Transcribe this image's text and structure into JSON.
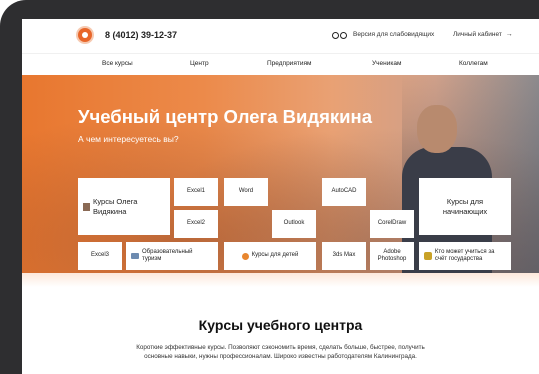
{
  "header": {
    "phone": "8 (4012) 39-12-37",
    "accessibility_label": "Версия для слабовидящих",
    "account_label": "Личный кабинет",
    "account_arrow": "→"
  },
  "nav": {
    "items": [
      "Все курсы",
      "Центр",
      "Предприятиям",
      "Ученикам",
      "Коллегам"
    ]
  },
  "hero": {
    "title": "Учебный центр Олега Видякина",
    "subtitle": "А чем интересуетесь вы?"
  },
  "tiles": {
    "courses_author": "Курсы Олега Видякина",
    "excel1": "Excel1",
    "word": "Word",
    "autocad": "AutoCAD",
    "beginners": "Курсы для начинающих",
    "excel2": "Excel2",
    "outlook": "Outlook",
    "coreldraw": "CorelDraw",
    "excel3": "Excel3",
    "edu_tourism": "Образовательный туризм",
    "kids": "Курсы для детей",
    "max3ds": "3ds Max",
    "photoshop": "Adobe Photoshop",
    "state_funded": "Кто может учиться за счёт государства"
  },
  "section": {
    "title": "Курсы учебного центра",
    "text": "Короткие эффективные курсы. Позволяют сэкономить время, сделать больше, быстрее, получить основные навыки, нужны профессионалам. Широко известны работодателям Калининграда."
  },
  "colors": {
    "accent": "#e8662a",
    "hero_gradient_start": "#e8772f",
    "frame": "#2e2e30"
  },
  "icons": {
    "logo": "logo-icon",
    "glasses": "glasses-icon",
    "account_arrow": "arrow-right-icon",
    "author": "portrait-icon",
    "tourism": "bag-icon",
    "kids": "kid-icon",
    "state": "crest-icon"
  }
}
